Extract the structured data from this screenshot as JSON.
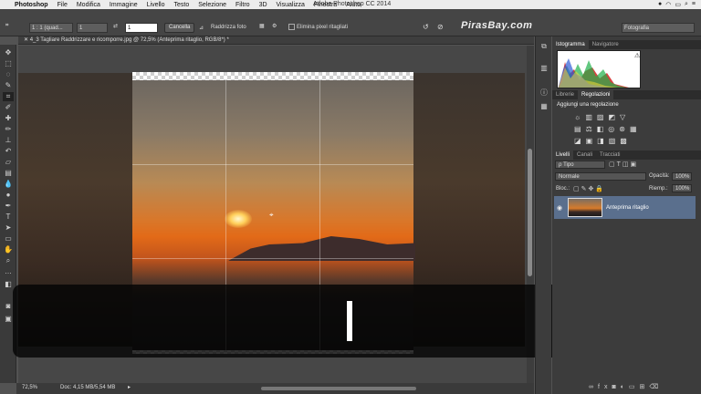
{
  "menubar": {
    "items": [
      "Photoshop",
      "File",
      "Modifica",
      "Immagine",
      "Livello",
      "Testo",
      "Selezione",
      "Filtro",
      "3D",
      "Visualizza",
      "Finestra",
      "Aiuto"
    ],
    "app_title": "Adobe Photoshop CC 2014"
  },
  "options": {
    "ratio": "1 : 1 (quad...",
    "ratio_w": "1",
    "ratio_h": "1",
    "cancel_label": "Cancella",
    "straighten_label": "Raddrizza foto",
    "delete_pixels_label": "Elimina pixel ritagliati",
    "workspace": "Fotografia"
  },
  "watermark": "PirasBay.com",
  "document": {
    "tab_title": "4_3 Tagliare Raddrizzare e ricomporre.jpg @ 72,5% (Anteprima ritaglio, RGB/8*) *"
  },
  "status": {
    "zoom": "72,5%",
    "doc": "Doc: 4,15 MB/5,54 MB"
  },
  "panels": {
    "histogram_tabs": [
      "Istogramma",
      "Navigatore"
    ],
    "adjust_tabs": [
      "Librerie",
      "Regolazioni"
    ],
    "adjust_title": "Aggiungi una regolazione",
    "layer_tabs": [
      "Livelli",
      "Canali",
      "Tracciati"
    ],
    "filter_kind": "ρ Tipo",
    "blend_mode": "Normale",
    "opacity_label": "Opacità:",
    "opacity_value": "100%",
    "lock_label": "Bloc.:",
    "fill_label": "Riemp.:",
    "fill_value": "100%",
    "layer_name": "Anteprima ritaglio"
  },
  "colors": {
    "accent_layer": "#5a6f8d",
    "panel_bg": "#3c3c3c"
  }
}
